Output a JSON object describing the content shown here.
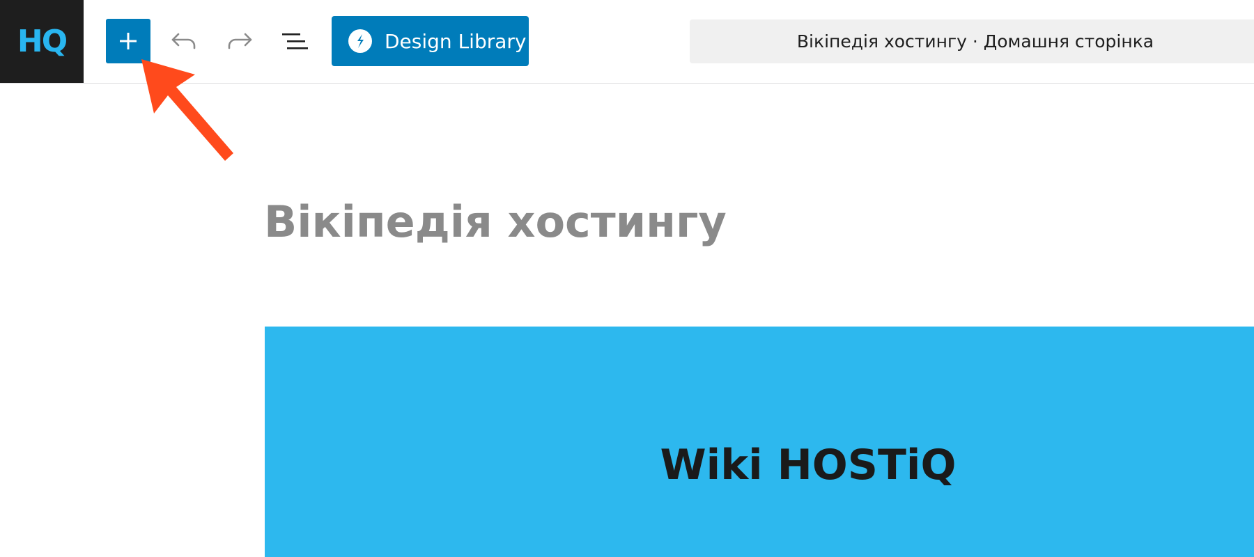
{
  "app": {
    "logo_text": "HQ"
  },
  "toolbar": {
    "inserter_icon": "plus-icon",
    "undo_icon": "undo-icon",
    "redo_icon": "redo-icon",
    "list_view_icon": "list-view-icon",
    "design_library_label": "Design Library",
    "design_library_icon": "stackable-logo-icon",
    "document_title": "Вікіпедія хостингу · Домашня сторінка"
  },
  "editor": {
    "post_title": "Вікіпедія хостингу",
    "hero_heading": "Wiki HOSTiQ"
  },
  "colors": {
    "accent": "#007cba",
    "logo_bg": "#1e1e1e",
    "logo_text": "#29b6f0",
    "hero_bg": "#2db8ee",
    "arrow": "#ff4a1c"
  }
}
